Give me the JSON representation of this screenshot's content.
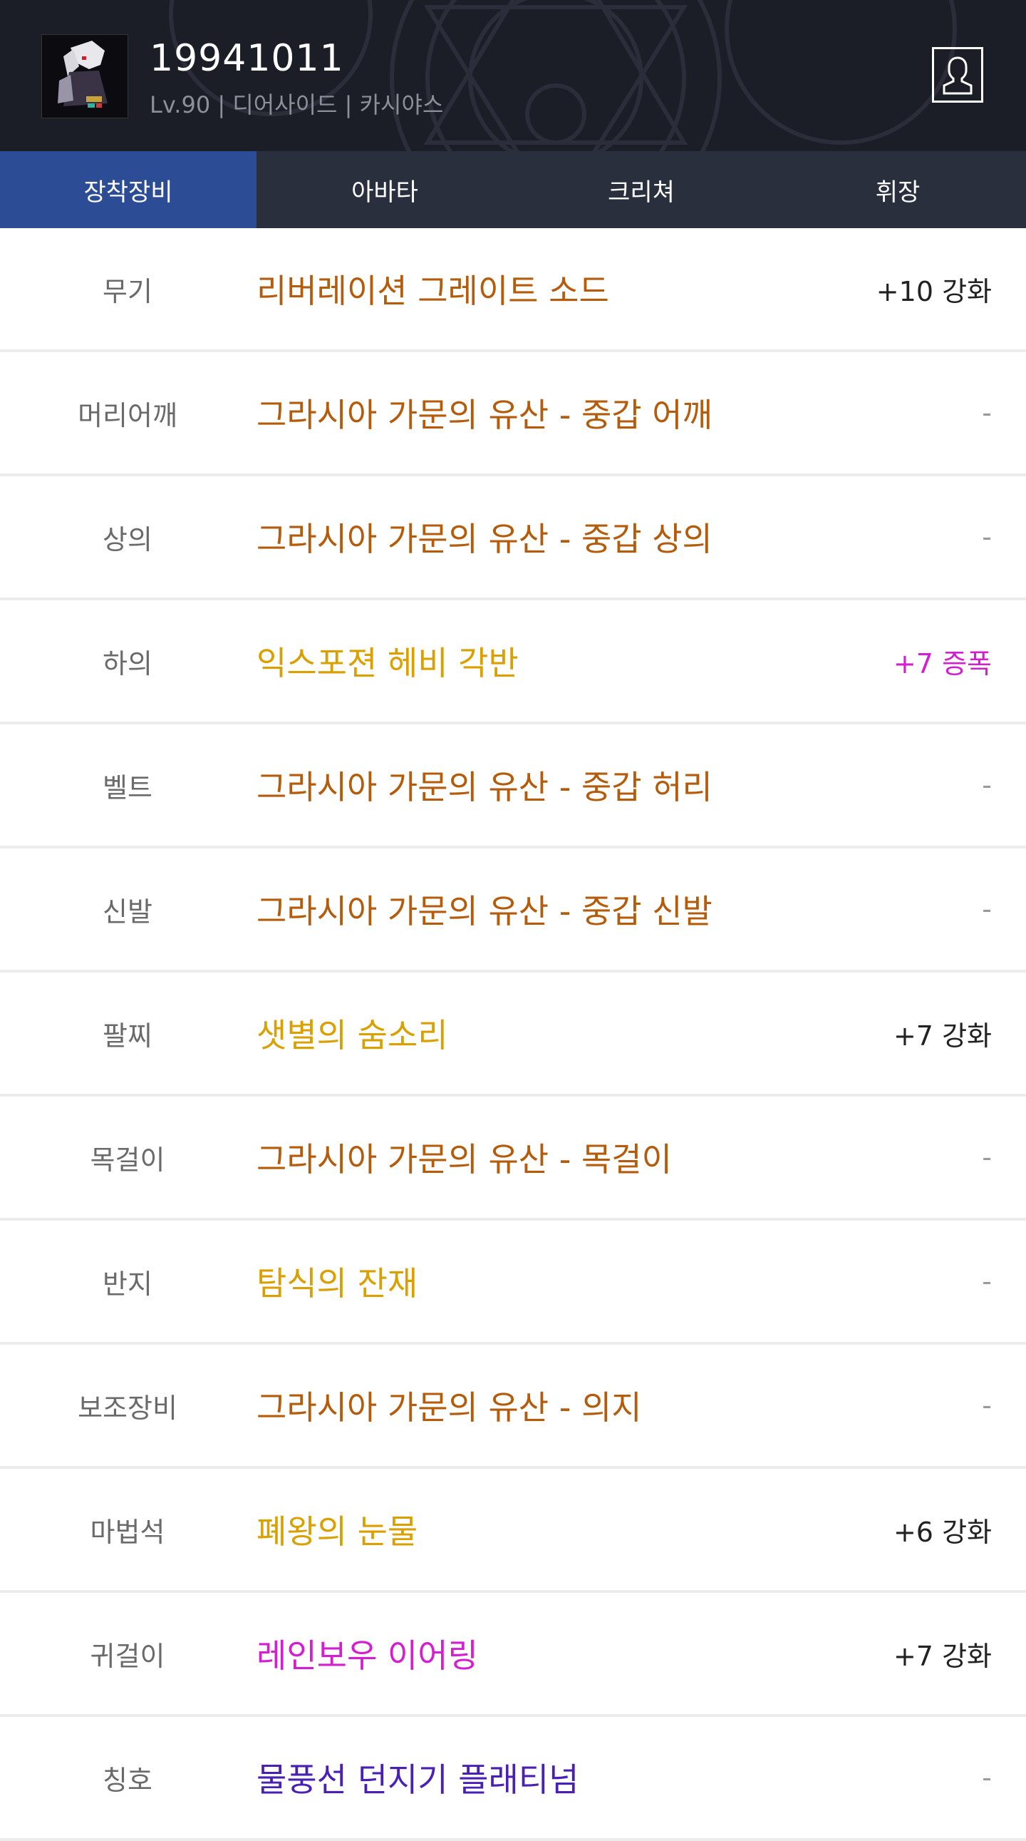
{
  "header": {
    "name": "19941011",
    "subinfo": "Lv.90 | 디어사이드 | 카시야스"
  },
  "tabs": [
    {
      "label": "장착장비",
      "active": true
    },
    {
      "label": "아바타",
      "active": false
    },
    {
      "label": "크리쳐",
      "active": false
    },
    {
      "label": "휘장",
      "active": false
    }
  ],
  "colors": {
    "epic": "#b45c0c",
    "legendary": "#d9a000",
    "unique": "#d41fd0",
    "rare": "#4a1fb4",
    "tab_active": "#2c4d96",
    "amp": "#d41fd0"
  },
  "equipment": [
    {
      "slot": "무기",
      "item": "리버레이션 그레이트 소드",
      "enh": "+10 강화",
      "rarity": "epic"
    },
    {
      "slot": "머리어깨",
      "item": "그라시아 가문의 유산 - 중갑 어깨",
      "enh": "-",
      "rarity": "epic"
    },
    {
      "slot": "상의",
      "item": "그라시아 가문의 유산 - 중갑 상의",
      "enh": "-",
      "rarity": "epic"
    },
    {
      "slot": "하의",
      "item": "익스포젼 헤비 각반",
      "enh": "+7 증폭",
      "rarity": "legendary",
      "amp": true
    },
    {
      "slot": "벨트",
      "item": "그라시아 가문의 유산 - 중갑 허리",
      "enh": "-",
      "rarity": "epic"
    },
    {
      "slot": "신발",
      "item": "그라시아 가문의 유산 - 중갑 신발",
      "enh": "-",
      "rarity": "epic"
    },
    {
      "slot": "팔찌",
      "item": "샛별의 숨소리",
      "enh": "+7 강화",
      "rarity": "legendary"
    },
    {
      "slot": "목걸이",
      "item": "그라시아 가문의 유산 - 목걸이",
      "enh": "-",
      "rarity": "epic"
    },
    {
      "slot": "반지",
      "item": "탐식의 잔재",
      "enh": "-",
      "rarity": "legendary"
    },
    {
      "slot": "보조장비",
      "item": "그라시아 가문의 유산 - 의지",
      "enh": "-",
      "rarity": "epic"
    },
    {
      "slot": "마법석",
      "item": "폐왕의 눈물",
      "enh": "+6 강화",
      "rarity": "legendary"
    },
    {
      "slot": "귀걸이",
      "item": "레인보우 이어링",
      "enh": "+7 강화",
      "rarity": "unique"
    },
    {
      "slot": "칭호",
      "item": "물풍선 던지기 플래티넘",
      "enh": "-",
      "rarity": "rare"
    }
  ]
}
